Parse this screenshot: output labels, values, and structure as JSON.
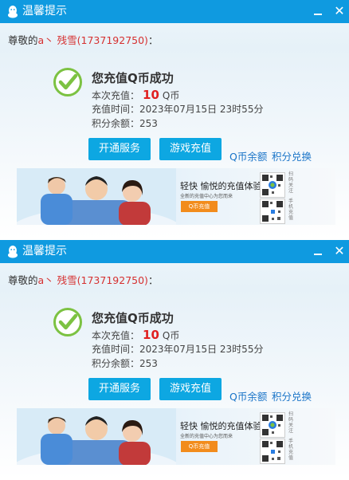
{
  "windows": [
    {
      "title": "温馨提示",
      "greeting_prefix": "尊敬的",
      "greeting_user": "a丶 残雪(1737192750)",
      "greeting_suffix": "：",
      "success_heading": "您充值Q币成功",
      "amount_label": "本次充值：",
      "amount_value": "10",
      "amount_unit": "Q币",
      "time_label": "充值时间：",
      "time_value": "2023年07月15日 23时55分",
      "points_label": "积分余额：",
      "points_value": "253",
      "btn_open_service": "开通服务",
      "btn_game_recharge": "游戏充值",
      "link_qbalance": "Q币余额",
      "link_points": "积分兑换",
      "banner_slogan": "轻快 愉悦的充值体验",
      "banner_sub": "全新的充值中心为您而来",
      "banner_button": "Q币充值",
      "banner_qr_text_1": "扫码关注",
      "banner_qr_text_2": "手机充值"
    },
    {
      "title": "温馨提示",
      "greeting_prefix": "尊敬的",
      "greeting_user": "a丶 残雪(1737192750)",
      "greeting_suffix": "：",
      "success_heading": "您充值Q币成功",
      "amount_label": "本次充值：",
      "amount_value": "10",
      "amount_unit": "Q币",
      "time_label": "充值时间：",
      "time_value": "2023年07月15日 23时55分",
      "points_label": "积分余额：",
      "points_value": "253",
      "btn_open_service": "开通服务",
      "btn_game_recharge": "游戏充值",
      "link_qbalance": "Q币余额",
      "link_points": "积分兑换",
      "banner_slogan": "轻快 愉悦的充值体验",
      "banner_sub": "全新的充值中心为您而来",
      "banner_button": "Q币充值",
      "banner_qr_text_1": "扫码关注",
      "banner_qr_text_2": "手机充值"
    }
  ],
  "colors": {
    "titlebar": "#0f9ae0",
    "button": "#0da7e2",
    "link": "#1a74c8",
    "username": "#d63030",
    "amount": "#e02020",
    "check": "#7cc242"
  },
  "icons": {
    "titlebar_logo": "qq-penguin-icon",
    "success": "check-circle-icon",
    "minimize": "minimize-icon",
    "close": "close-icon"
  }
}
